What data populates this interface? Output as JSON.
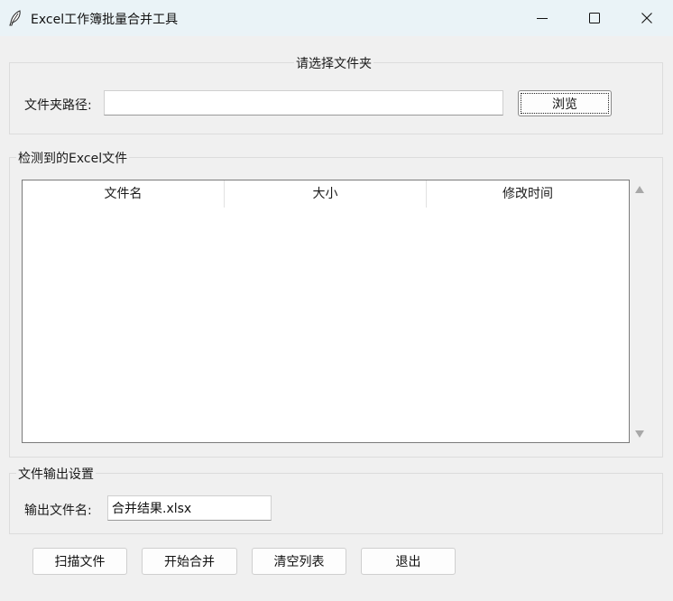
{
  "window": {
    "title": "Excel工作簿批量合并工具",
    "icon": "feather-icon",
    "controls": [
      "minimize-icon",
      "maximize-icon",
      "close-icon"
    ]
  },
  "folder_section": {
    "title": "请选择文件夹",
    "path_label": "文件夹路径:",
    "path_value": "",
    "browse_label": "浏览"
  },
  "files_section": {
    "title": "检测到的Excel文件",
    "columns": [
      "文件名",
      "大小",
      "修改时间"
    ],
    "rows": []
  },
  "output_section": {
    "title": "文件输出设置",
    "filename_label": "输出文件名:",
    "filename_value": "合并结果.xlsx"
  },
  "actions": {
    "scan": "扫描文件",
    "merge": "开始合并",
    "clear": "清空列表",
    "exit": "退出"
  }
}
